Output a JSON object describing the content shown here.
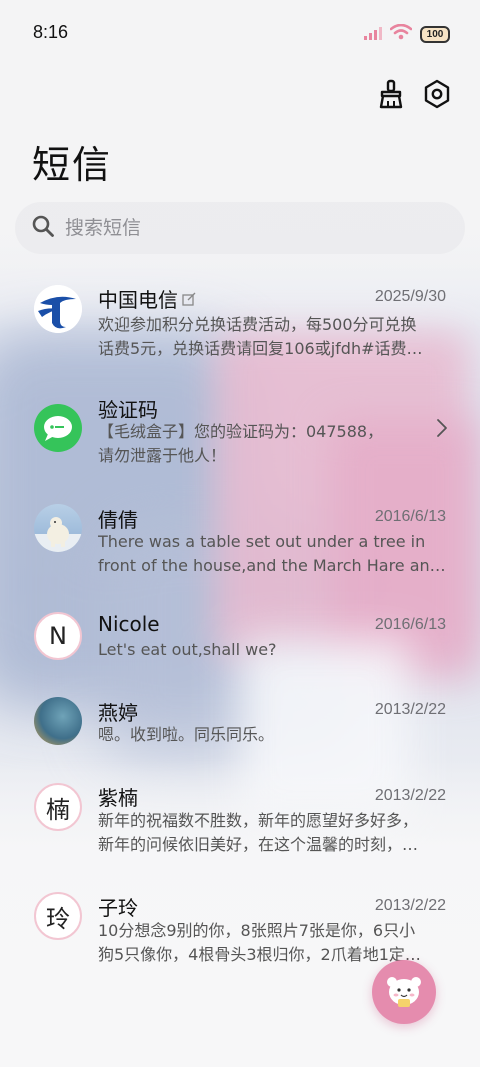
{
  "status_bar": {
    "time": "8:16",
    "battery": "100"
  },
  "page_title": "短信",
  "search": {
    "placeholder": "搜索短信"
  },
  "messages": [
    {
      "name": "中国电信",
      "date": "2025/9/30",
      "line1": "欢迎参加积分兑换话费活动，每500分可兑换",
      "line2": "话费5元，兑换话费请回复106或jfdh#话费…"
    },
    {
      "name": "验证码",
      "date": "",
      "line1": "【毛绒盒子】您的验证码为：047588，",
      "line2": "请勿泄露于他人！"
    },
    {
      "name": "倩倩",
      "date": "2016/6/13",
      "line1": "There was a table set out under a tree in",
      "line2": "front of the house,and the March Hare an…"
    },
    {
      "name": "Nicole",
      "date": "2016/6/13",
      "avatar_letter": "N",
      "line1": "Let's eat out,shall we?",
      "line2": ""
    },
    {
      "name": "燕婷",
      "date": "2013/2/22",
      "line1": "嗯。收到啦。同乐同乐。",
      "line2": ""
    },
    {
      "name": "紫楠",
      "date": "2013/2/22",
      "avatar_letter": "楠",
      "line1": "新年的祝福数不胜数，新年的愿望好多好多，",
      "line2": "新年的问候依旧美好，在这个温馨的时刻，…"
    },
    {
      "name": "子玲",
      "date": "2013/2/22",
      "avatar_letter": "玲",
      "line1": "10分想念9别的你，8张照片7张是你，6只小",
      "line2": "狗5只像你，4根骨头3根归你，2爪着地1定…"
    }
  ],
  "colors": {
    "telecom_blue": "#1a4fa8",
    "sms_green": "#35c45a",
    "fab_pink": "#e58cae",
    "avatar_border": "#f2c6d2"
  },
  "icons": [
    "signal-icon",
    "wifi-icon",
    "battery-icon",
    "broom-icon",
    "settings-hex-icon",
    "search-icon",
    "edit-icon",
    "chevron-right-icon",
    "fab-mascot-icon"
  ]
}
